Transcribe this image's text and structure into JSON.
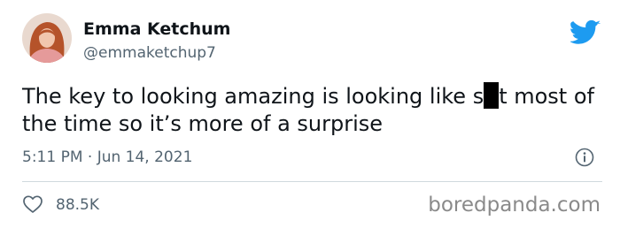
{
  "author": {
    "name": "Emma Ketchum",
    "handle": "@emmaketchup7"
  },
  "tweet": {
    "text_before_redaction": "The key to looking amazing is looking like s",
    "text_after_redaction": "t most of the time so it’s more of a surprise"
  },
  "meta": {
    "timestamp": "5:11 PM · Jun 14, 2021",
    "likes": "88.5K"
  },
  "watermark": "boredpanda.com",
  "icons": {
    "brand": "twitter-bird-icon",
    "info": "info-icon",
    "like": "heart-icon"
  },
  "colors": {
    "twitter_blue": "#1d9bf0",
    "secondary_text": "#536471"
  }
}
